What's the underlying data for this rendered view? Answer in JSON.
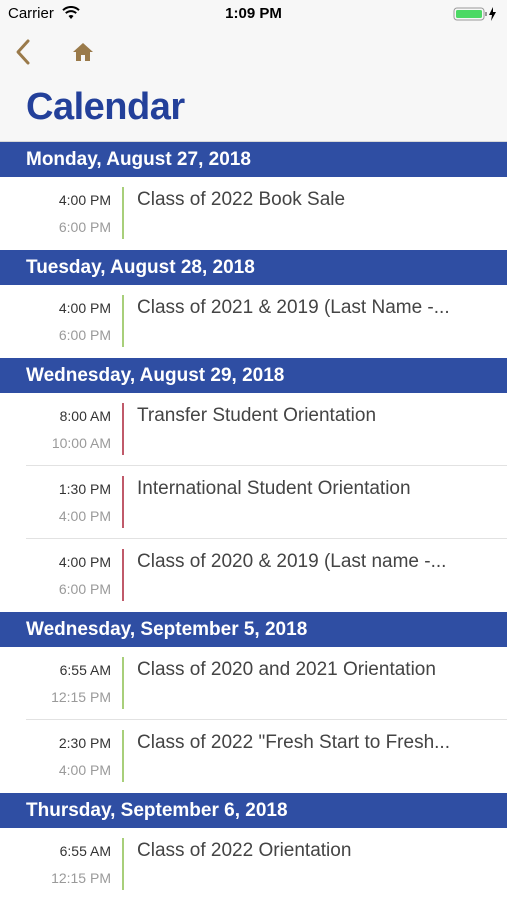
{
  "status_bar": {
    "carrier": "Carrier",
    "time": "1:09 PM"
  },
  "nav": {
    "title": "Calendar"
  },
  "colors": {
    "header_bg": "#2f4ea3",
    "title": "#23409a",
    "green_bar": "#a8cf7a",
    "red_bar": "#c05a6a",
    "nav_icons": "#9a7a4a"
  },
  "days": [
    {
      "label": "Monday, August 27, 2018",
      "events": [
        {
          "start": "4:00 PM",
          "end": "6:00 PM",
          "title": "Class of 2022 Book Sale",
          "bar": "green"
        }
      ]
    },
    {
      "label": "Tuesday, August 28, 2018",
      "events": [
        {
          "start": "4:00 PM",
          "end": "6:00 PM",
          "title": "Class of 2021 & 2019 (Last Name -...",
          "bar": "green"
        }
      ]
    },
    {
      "label": "Wednesday, August 29, 2018",
      "events": [
        {
          "start": "8:00 AM",
          "end": "10:00 AM",
          "title": "Transfer Student Orientation",
          "bar": "red"
        },
        {
          "start": "1:30 PM",
          "end": "4:00 PM",
          "title": "International Student Orientation",
          "bar": "red"
        },
        {
          "start": "4:00 PM",
          "end": "6:00 PM",
          "title": "Class of 2020 & 2019 (Last name -...",
          "bar": "red"
        }
      ]
    },
    {
      "label": "Wednesday, September 5, 2018",
      "events": [
        {
          "start": "6:55 AM",
          "end": "12:15 PM",
          "title": "Class of 2020 and 2021 Orientation",
          "bar": "green"
        },
        {
          "start": "2:30 PM",
          "end": "4:00 PM",
          "title": "Class of 2022 \"Fresh Start to Fresh...",
          "bar": "green"
        }
      ]
    },
    {
      "label": "Thursday, September 6, 2018",
      "events": [
        {
          "start": "6:55 AM",
          "end": "12:15 PM",
          "title": "Class of 2022 Orientation",
          "bar": "green"
        }
      ]
    }
  ]
}
